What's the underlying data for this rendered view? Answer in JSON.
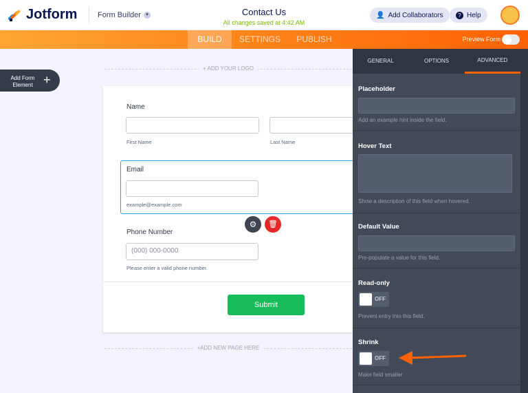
{
  "header": {
    "logo": "Jotform",
    "builder": "Form Builder",
    "title": "Contact Us",
    "saved": "All changes saved at 4:42 AM",
    "collab": "Add Collaborators",
    "help": "Help"
  },
  "nav": {
    "tabs": [
      "BUILD",
      "SETTINGS",
      "PUBLISH"
    ],
    "preview": "Preview Form"
  },
  "canvas": {
    "add_element": "Add Form Element",
    "add_logo": "+ ADD YOUR LOGO",
    "add_page": "+ADD NEW PAGE HERE"
  },
  "form": {
    "name_label": "Name",
    "first": "First Name",
    "last": "Last Name",
    "email_label": "Email",
    "email_hint": "example@example.com",
    "phone_label": "Phone Number",
    "phone_placeholder": "(000) 000-0000",
    "phone_hint": "Please enter a valid phone number.",
    "submit": "Submit"
  },
  "panel": {
    "tabs": [
      "GENERAL",
      "OPTIONS",
      "ADVANCED"
    ],
    "placeholder": {
      "label": "Placeholder",
      "hint": "Add an example hint inside the field."
    },
    "hover": {
      "label": "Hover Text",
      "hint": "Show a description of this field when hovered."
    },
    "default": {
      "label": "Default Value",
      "hint": "Pre-populate a value for this field."
    },
    "readonly": {
      "label": "Read-only",
      "state": "OFF",
      "hint": "Prevent entry into this field."
    },
    "shrink": {
      "label": "Shrink",
      "state": "OFF",
      "hint": "Make field smaller"
    }
  },
  "colors": {
    "accent": "#ff6100",
    "submit": "#18bd5b",
    "selected": "#2e9fe6"
  }
}
